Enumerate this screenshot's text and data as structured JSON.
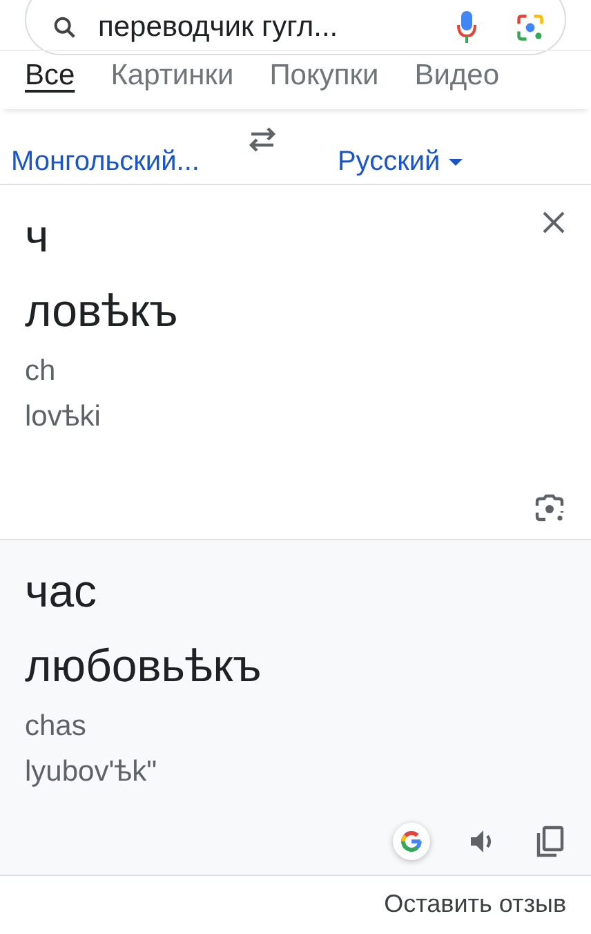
{
  "search": {
    "value": "переводчик гугл..."
  },
  "tabs": [
    {
      "label": "Все",
      "selected": true
    },
    {
      "label": "Картинки",
      "selected": false
    },
    {
      "label": "Покупки",
      "selected": false
    },
    {
      "label": "Видео",
      "selected": false
    }
  ],
  "languages": {
    "source": "Монгольский...",
    "target": "Русский"
  },
  "source": {
    "lines": [
      "ч",
      "ловѣкъ"
    ],
    "transliteration": [
      "ch",
      "lovѣki"
    ]
  },
  "result": {
    "lines": [
      "час",
      "любовьѣкъ"
    ],
    "transliteration": [
      "chas",
      "lyubov'ѣk\""
    ]
  },
  "feedback": "Оставить отзыв"
}
